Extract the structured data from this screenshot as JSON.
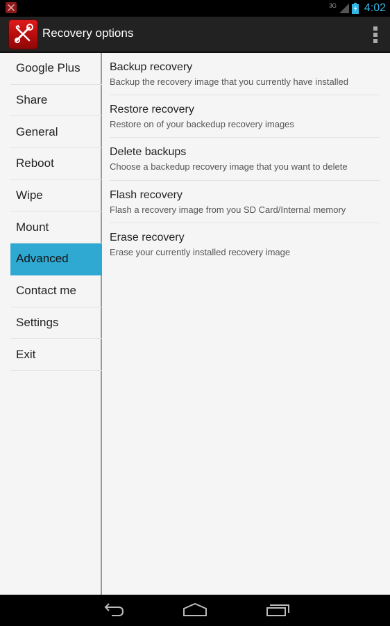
{
  "status_bar": {
    "app_icon": "tools-icon",
    "network_type": "3G",
    "signal_icon": "cell-signal-icon",
    "battery_icon": "battery-charging-icon",
    "time": "4:02"
  },
  "action_bar": {
    "app_icon": "wrench-screwdriver-icon",
    "title": "Recovery options",
    "overflow_icon": "overflow-menu-icon",
    "accent_color": "#e01b1b"
  },
  "sidebar": {
    "selected_color": "#2fa9d2",
    "items": [
      {
        "label": "Google Plus",
        "selected": false
      },
      {
        "label": "Share",
        "selected": false
      },
      {
        "label": "General",
        "selected": false
      },
      {
        "label": "Reboot",
        "selected": false
      },
      {
        "label": "Wipe",
        "selected": false
      },
      {
        "label": "Mount",
        "selected": false
      },
      {
        "label": "Advanced",
        "selected": true
      },
      {
        "label": "Contact me",
        "selected": false
      },
      {
        "label": "Settings",
        "selected": false
      },
      {
        "label": "Exit",
        "selected": false
      }
    ]
  },
  "options": [
    {
      "title": "Backup recovery",
      "subtitle": "Backup the recovery image that you currently have installed"
    },
    {
      "title": "Restore recovery",
      "subtitle": "Restore on of your backedup recovery images"
    },
    {
      "title": "Delete backups",
      "subtitle": "Choose a backedup recovery image that you want to delete"
    },
    {
      "title": "Flash recovery",
      "subtitle": "Flash a recovery image from you SD Card/Internal memory"
    },
    {
      "title": "Erase recovery",
      "subtitle": "Erase your currently installed recovery image"
    }
  ],
  "nav_bar": {
    "back_icon": "back-icon",
    "home_icon": "home-icon",
    "recents_icon": "recent-apps-icon"
  }
}
